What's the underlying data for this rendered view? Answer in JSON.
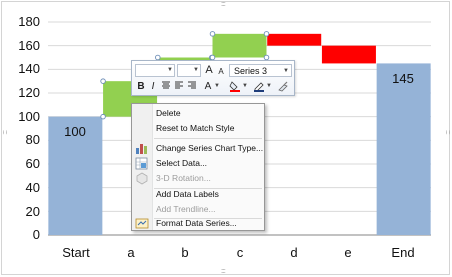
{
  "chart_data": {
    "type": "bar",
    "subtype": "waterfall",
    "categories": [
      "Start",
      "a",
      "b",
      "c",
      "d",
      "e",
      "End"
    ],
    "ylim": [
      0,
      180
    ],
    "yticks": [
      0,
      20,
      40,
      60,
      80,
      100,
      120,
      140,
      160,
      180
    ],
    "grid": true,
    "series": [
      {
        "name": "",
        "role": "start-end",
        "color": "#95b3d7",
        "values": [
          100,
          null,
          null,
          null,
          null,
          null,
          145
        ]
      },
      {
        "name": "",
        "role": "increase",
        "color": "#92d050",
        "ranges": [
          null,
          [
            100,
            130
          ],
          [
            130,
            150
          ],
          [
            150,
            170
          ],
          null,
          null,
          null
        ]
      },
      {
        "name": "",
        "role": "decrease",
        "color": "#ff0000",
        "ranges": [
          null,
          null,
          null,
          null,
          [
            170,
            160
          ],
          [
            160,
            145
          ],
          null
        ]
      }
    ],
    "data_labels": [
      "100",
      "145"
    ]
  },
  "ticks": {
    "y": [
      "0",
      "20",
      "40",
      "60",
      "80",
      "100",
      "120",
      "140",
      "160",
      "180"
    ],
    "x": [
      "Start",
      "a",
      "b",
      "c",
      "d",
      "e",
      "End"
    ]
  },
  "labels": {
    "start": "100",
    "end": "145"
  },
  "minitoolbar": {
    "series_selector": "Series 3",
    "bold": "B",
    "italic": "I",
    "font_grow": "A",
    "font_shrink": "A",
    "font_color": "A"
  },
  "context_menu": {
    "items": [
      {
        "label": "Delete",
        "icon": "none",
        "enabled": true
      },
      {
        "label": "Reset to Match Style",
        "icon": "none",
        "enabled": true
      },
      {
        "label": "Change Series Chart Type...",
        "icon": "chart-type-icon",
        "enabled": true
      },
      {
        "label": "Select Data...",
        "icon": "select-data-icon",
        "enabled": true
      },
      {
        "label": "3-D Rotation...",
        "icon": "3d-rotation-icon",
        "enabled": false
      },
      {
        "label": "Add Data Labels",
        "icon": "none",
        "enabled": true
      },
      {
        "label": "Add Trendline...",
        "icon": "none",
        "enabled": false
      },
      {
        "label": "Format Data Series...",
        "icon": "format-series-icon",
        "enabled": true
      }
    ]
  }
}
